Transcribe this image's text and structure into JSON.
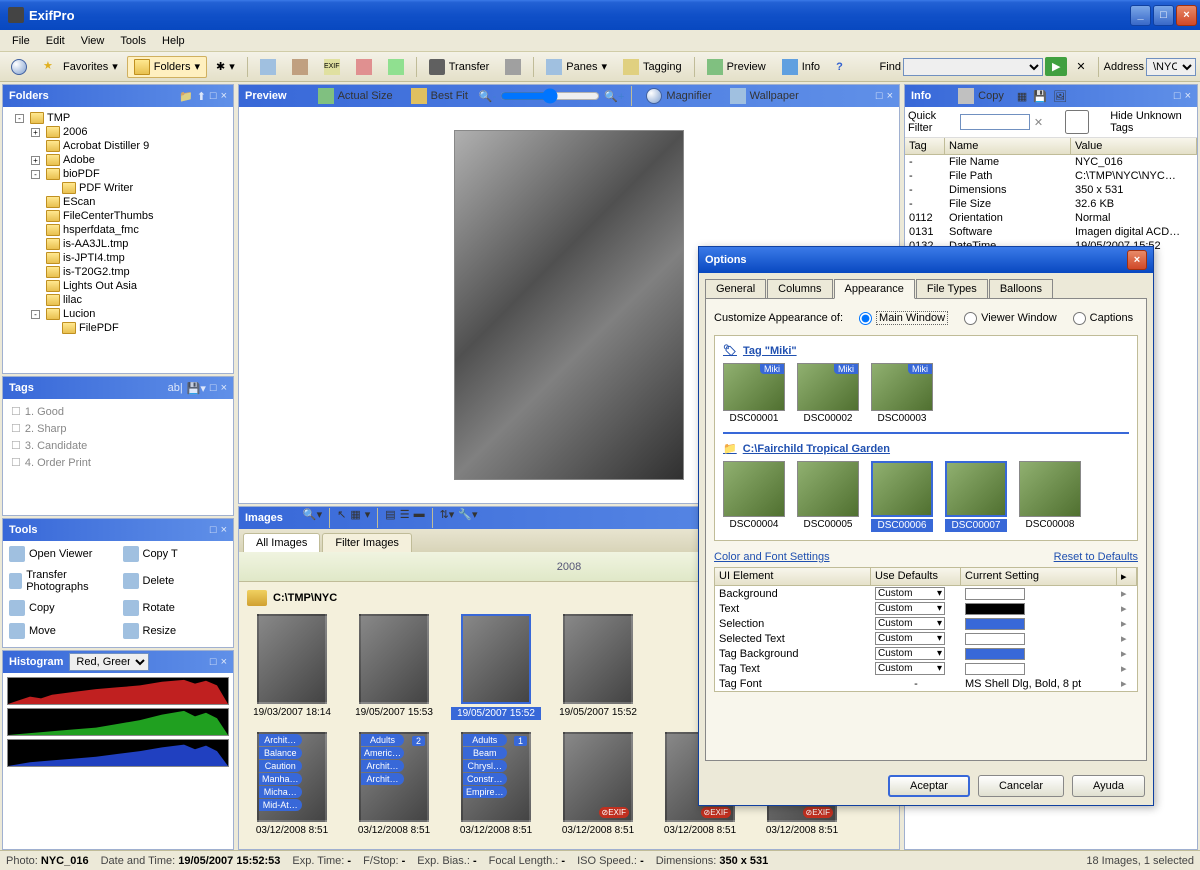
{
  "app": {
    "title": "ExifPro"
  },
  "menu": [
    "File",
    "Edit",
    "View",
    "Tools",
    "Help"
  ],
  "toolbar": {
    "favorites": "Favorites",
    "folders": "Folders",
    "transfer": "Transfer",
    "panes": "Panes",
    "tagging": "Tagging",
    "preview": "Preview",
    "info": "Info",
    "find_label": "Find",
    "address_label": "Address",
    "address_value": "\\NYC"
  },
  "folders": {
    "title": "Folders",
    "items": [
      {
        "name": "TMP",
        "exp": "-",
        "depth": 0
      },
      {
        "name": "2006",
        "exp": "+",
        "depth": 1
      },
      {
        "name": "Acrobat Distiller 9",
        "depth": 1
      },
      {
        "name": "Adobe",
        "exp": "+",
        "depth": 1
      },
      {
        "name": "bioPDF",
        "exp": "-",
        "depth": 1
      },
      {
        "name": "PDF Writer",
        "depth": 2
      },
      {
        "name": "EScan",
        "depth": 1
      },
      {
        "name": "FileCenterThumbs",
        "depth": 1
      },
      {
        "name": "hsperfdata_fmc",
        "depth": 1
      },
      {
        "name": "is-AA3JL.tmp",
        "depth": 1
      },
      {
        "name": "is-JPTI4.tmp",
        "depth": 1
      },
      {
        "name": "is-T20G2.tmp",
        "depth": 1
      },
      {
        "name": "Lights Out Asia",
        "depth": 1
      },
      {
        "name": "lilac",
        "depth": 1
      },
      {
        "name": "Lucion",
        "exp": "-",
        "depth": 1
      },
      {
        "name": "FilePDF",
        "depth": 2
      }
    ]
  },
  "tags": {
    "title": "Tags",
    "items": [
      "1. Good",
      "2. Sharp",
      "3. Candidate",
      "4. Order Print"
    ]
  },
  "tools": {
    "title": "Tools",
    "items": [
      {
        "l": "Open Viewer",
        "r": "Copy T"
      },
      {
        "l": "Transfer Photographs",
        "r": "Delete"
      },
      {
        "l": "Copy",
        "r": "Rotate"
      },
      {
        "l": "Move",
        "r": "Resize"
      }
    ]
  },
  "histogram": {
    "title": "Histogram",
    "mode": "Red, Green"
  },
  "preview": {
    "title": "Preview",
    "actual": "Actual Size",
    "bestfit": "Best Fit",
    "magnifier": "Magnifier",
    "wallpaper": "Wallpaper"
  },
  "images": {
    "title": "Images",
    "tab_all": "All Images",
    "tab_filter": "Filter Images",
    "year": "2008",
    "path": "C:\\TMP\\NYC",
    "row1": [
      {
        "date": "19/03/2007  18:14"
      },
      {
        "date": "19/05/2007  15:53"
      },
      {
        "date": "19/05/2007  15:52",
        "sel": true
      },
      {
        "date": "19/05/2007  15:52"
      }
    ],
    "row2": [
      {
        "date": "03/12/2008  8:51",
        "tags": [
          "Archit…",
          "Balance",
          "Caution",
          "Manha…",
          "Micha…",
          "Mid-At…"
        ]
      },
      {
        "date": "03/12/2008  8:51",
        "badge": "2",
        "tags": [
          "Adults",
          "Americ…",
          "Archit…",
          "Archit…"
        ]
      },
      {
        "date": "03/12/2008  8:51",
        "badge": "1",
        "tags": [
          "Adults",
          "Beam",
          "Chrysl…",
          "Constr…",
          "Empire…"
        ]
      },
      {
        "date": "03/12/2008  8:51",
        "exif": true
      },
      {
        "date": "03/12/2008  8:51",
        "exif": true
      },
      {
        "date": "03/12/2008  8:51",
        "exif": true
      }
    ]
  },
  "info": {
    "title": "Info",
    "copy": "Copy",
    "quick_filter": "Quick Filter",
    "hide_unknown": "Hide Unknown Tags",
    "cols": [
      "Tag",
      "Name",
      "Value"
    ],
    "rows": [
      {
        "t": "-",
        "n": "File Name",
        "v": "NYC_016"
      },
      {
        "t": "-",
        "n": "File Path",
        "v": "C:\\TMP\\NYC\\NYC…"
      },
      {
        "t": "-",
        "n": "Dimensions",
        "v": "350 x 531"
      },
      {
        "t": "-",
        "n": "File Size",
        "v": "32.6 KB"
      },
      {
        "t": "0112",
        "n": "Orientation",
        "v": "Normal"
      },
      {
        "t": "0131",
        "n": "Software",
        "v": "Imagen digital ACD…"
      },
      {
        "t": "0132",
        "n": "DateTime",
        "v": "19/05/2007  15:52"
      }
    ]
  },
  "options": {
    "title": "Options",
    "tabs": [
      "General",
      "Columns",
      "Appearance",
      "File Types",
      "Balloons"
    ],
    "active_tab": 2,
    "customize_label": "Customize Appearance of:",
    "radios": [
      "Main Window",
      "Viewer Window",
      "Captions"
    ],
    "tag_section": "Tag \"Miki\"",
    "tag_thumbs": [
      "DSC00001",
      "DSC00002",
      "DSC00003"
    ],
    "tag_badge": "Miki",
    "path_section": "C:\\Fairchild Tropical Garden",
    "path_thumbs": [
      "DSC00004",
      "DSC00005",
      "DSC00006",
      "DSC00007",
      "DSC00008"
    ],
    "settings_label": "Color and Font Settings",
    "reset": "Reset to Defaults",
    "set_cols": [
      "UI Element",
      "Use Defaults",
      "Current Setting"
    ],
    "settings": [
      {
        "n": "Background",
        "d": "Custom",
        "c": "#ffffff"
      },
      {
        "n": "Text",
        "d": "Custom",
        "c": "#000000"
      },
      {
        "n": "Selection",
        "d": "Custom",
        "c": "#3868d8"
      },
      {
        "n": "Selected Text",
        "d": "Custom",
        "c": "#ffffff"
      },
      {
        "n": "Tag Background",
        "d": "Custom",
        "c": "#3868d8"
      },
      {
        "n": "Tag Text",
        "d": "Custom",
        "c": "#ffffff"
      },
      {
        "n": "Tag Font",
        "d": "-",
        "c": "MS Shell Dlg, Bold, 8 pt",
        "text": true
      }
    ],
    "btns": [
      "Aceptar",
      "Cancelar",
      "Ayuda"
    ]
  },
  "status": {
    "photo_l": "Photo:",
    "photo": "NYC_016",
    "dt_l": "Date and Time:",
    "dt": "19/05/2007  15:52:53",
    "exp_l": "Exp. Time:",
    "exp": "-",
    "fstop_l": "F/Stop:",
    "fstop": "-",
    "bias_l": "Exp. Bias.:",
    "bias": "-",
    "flen_l": "Focal Length.:",
    "flen": "-",
    "iso_l": "ISO Speed.:",
    "iso": "-",
    "dim_l": "Dimensions:",
    "dim": "350 x 531",
    "count": "18 Images, 1 selected"
  }
}
